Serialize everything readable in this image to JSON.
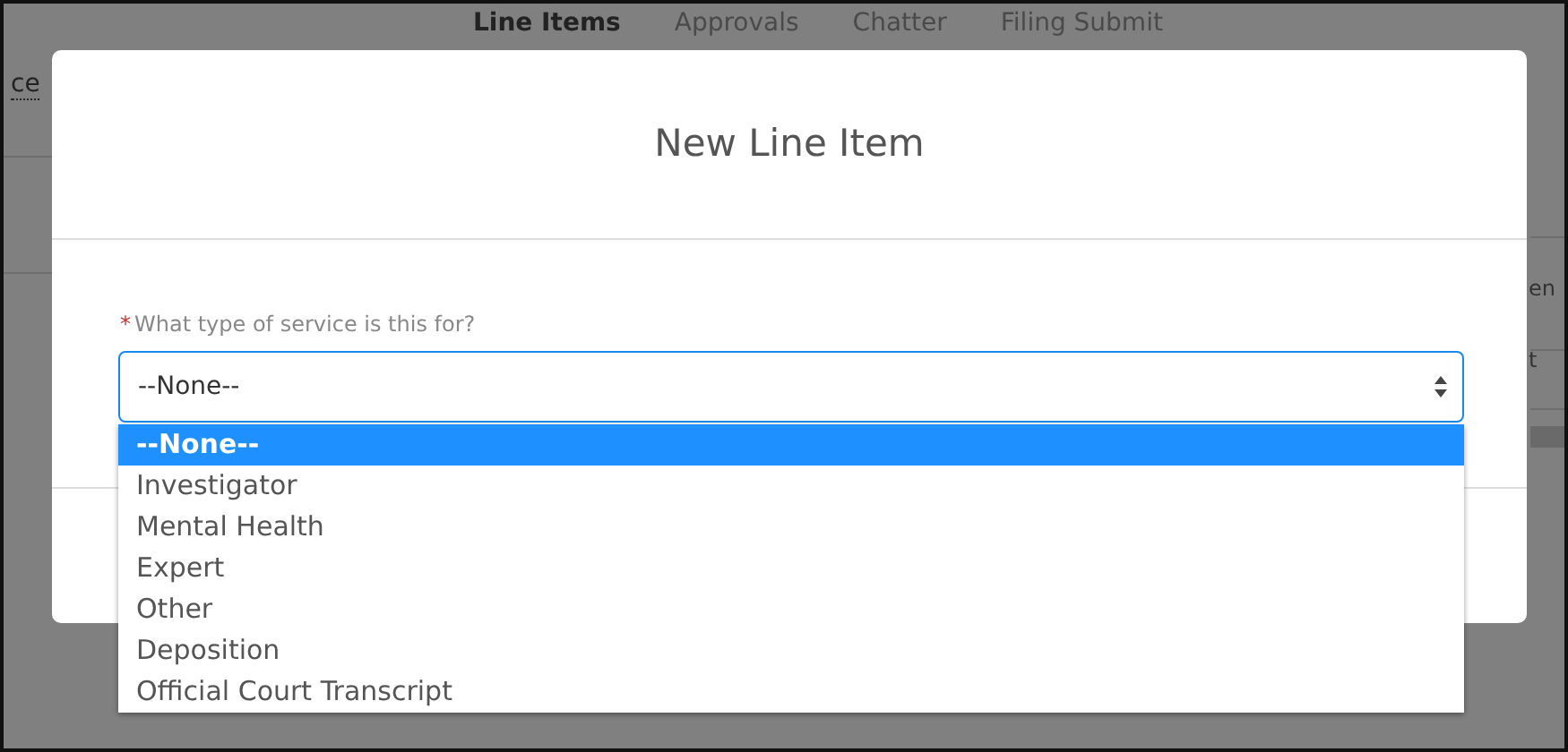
{
  "background": {
    "tabs": [
      {
        "label": "Line Items",
        "selected": true
      },
      {
        "label": "Approvals",
        "selected": false
      },
      {
        "label": "Chatter",
        "selected": false
      },
      {
        "label": "Filing Submit",
        "selected": false
      }
    ],
    "left_fragment": "ce",
    "right_fragments": [
      "en",
      "t"
    ]
  },
  "modal": {
    "title": "New Line Item",
    "field": {
      "label": "What type of service is this for?",
      "required_mark": "*",
      "value": "--None--",
      "options": [
        {
          "label": "--None--",
          "selected": true
        },
        {
          "label": "Investigator",
          "selected": false
        },
        {
          "label": "Mental Health",
          "selected": false
        },
        {
          "label": "Expert",
          "selected": false
        },
        {
          "label": "Other",
          "selected": false
        },
        {
          "label": "Deposition",
          "selected": false
        },
        {
          "label": "Official Court Transcript",
          "selected": false
        }
      ]
    }
  }
}
